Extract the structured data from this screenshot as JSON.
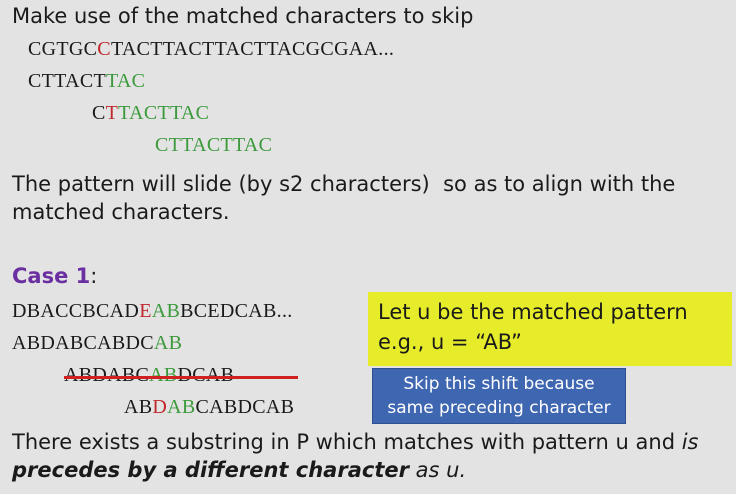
{
  "heading": "Make use of the matched characters to skip",
  "text_line": [
    {
      "pre": "CGTGC",
      "red": "C",
      "post": "TACTTACTTACTTACGCGAA..."
    }
  ],
  "pattern1": {
    "black": "CTTACT",
    "green": "TAC"
  },
  "pattern2": {
    "black": "C",
    "red": "T",
    "green": "TACTTAC"
  },
  "pattern3": {
    "green": "CTTACTTAC"
  },
  "explain_line1": "The pattern will slide (by s2 characters)  so as to align with the",
  "explain_line2": "matched characters.",
  "case_label": "Case 1",
  "case_colon": ":",
  "case_text": {
    "pre": "DBACCBCAD",
    "red": "E",
    "green": "AB",
    "post": "BCEDCAB..."
  },
  "case_pattern1": {
    "black": "ABDABCABDC",
    "green": "AB"
  },
  "case_pattern2_struck": {
    "pre": "ABDABC",
    "green": "AB",
    "post": "DCAB"
  },
  "case_pattern3": {
    "pre": "AB",
    "red": "D",
    "green": "AB",
    "post": "CABDCAB"
  },
  "callout_yellow": {
    "line1": "Let u be the matched pattern",
    "line2": "e.g., u = “AB”"
  },
  "callout_blue": {
    "line1": "Skip this shift because",
    "line2": "same preceding character"
  },
  "footer": {
    "part1": "There exists a substring in P which matches with pattern u and ",
    "part2": "is",
    "part3": "precedes by a different character",
    "part4": " as u."
  },
  "colors": {
    "red": "#c0282d",
    "green": "#3c9a3c",
    "purple": "#6a2fa0",
    "yellow": "#e6ec2a",
    "blue": "#3f66b0"
  }
}
